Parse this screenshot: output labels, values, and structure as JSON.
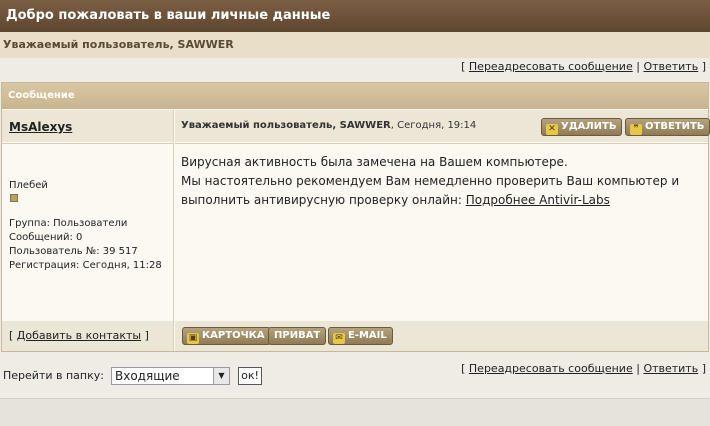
{
  "header": {
    "title": "Добро пожаловать в ваши личные данные",
    "welcome": "Уважаемый пользователь, SAWWER"
  },
  "actions": {
    "open": "[",
    "forward": "Переадресовать сообщение",
    "sep": "|",
    "reply": "Ответить",
    "close": "]"
  },
  "message": {
    "section_title": "Сообщение",
    "author": "MsAlexys",
    "subject": "Уважаемый пользователь, SAWWER",
    "date": ", Сегодня, 19:14",
    "delete_label": "УДАЛИТЬ",
    "reply_label": "ОТВЕТИТЬ",
    "rank": "Плебей",
    "stats": {
      "group": "Группа: Пользователи",
      "posts": "Сообщений: 0",
      "user_no": "Пользователь №: 39 517",
      "registered": "Регистрация: Сегодня, 11:28"
    },
    "body_line1": "Вирусная активность была замечена на Вашем компьютере.",
    "body_line2": "Мы настоятельно рекомендуем Вам немедленно проверить Ваш компьютер и выполнить антивирусную проверку онлайн: ",
    "body_link": "Подробнее Antivir-Labs",
    "add_contact": "Добавить в контакты",
    "card_label": "КАРТОЧКА",
    "private_label": "ПРИВАТ",
    "email_label": "E-MAIL"
  },
  "folder": {
    "label": "Перейти в папку:",
    "selected": "Входящие",
    "ok_label": "ок!"
  },
  "colors": {
    "title_bar": "#6b5139",
    "header_band": "#d1bf9b",
    "button": "#9e8a63"
  }
}
